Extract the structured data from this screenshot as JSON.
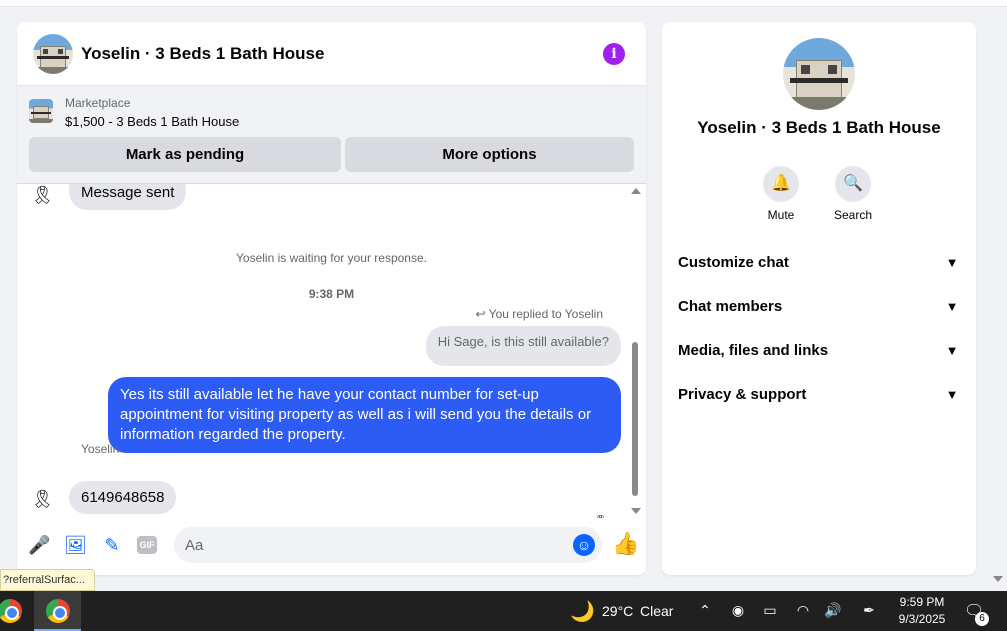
{
  "chat": {
    "title": "Yoselin · 3 Beds 1 Bath House",
    "marketplace_label": "Marketplace",
    "listing": "$1,500 - 3 Beds 1 Bath House",
    "mark_pending": "Mark as pending",
    "more_options": "More options"
  },
  "messages": {
    "partial_msg": "Message sent",
    "waiting": "Yoselin is waiting for your response.",
    "time": "9:38 PM",
    "replied": "You replied to Yoselin",
    "quoted": "Hi Sage, is this still available?",
    "reply": "Yes its still available let he have your contact number for set-up appointment for visiting property as well as i will send you the details or information regarded the property.",
    "sender": "Yoselin",
    "incoming": "6149648658"
  },
  "composer": {
    "placeholder": "Aa",
    "gif": "GIF"
  },
  "side": {
    "title": "Yoselin · 3 Beds 1 Bath House",
    "mute": "Mute",
    "search": "Search",
    "items": [
      "Customize chat",
      "Chat members",
      "Media, files and links",
      "Privacy & support"
    ]
  },
  "tooltip": "?referralSurfac...",
  "taskbar": {
    "temp": "29°C",
    "condition": "Clear",
    "time": "9:59 PM",
    "date": "9/3/2025",
    "notif_count": "6"
  },
  "icons": {
    "info": "info-icon",
    "mic": "microphone-icon",
    "photo": "photo-icon",
    "sticker": "sticker-icon",
    "emoji": "emoji-icon",
    "like": "thumbs-up-icon",
    "bell": "bell-icon",
    "search": "search-icon"
  },
  "colors": {
    "accent": "#0866ff",
    "bubble_out": "#2d5cf5",
    "info": "#a020f0"
  }
}
